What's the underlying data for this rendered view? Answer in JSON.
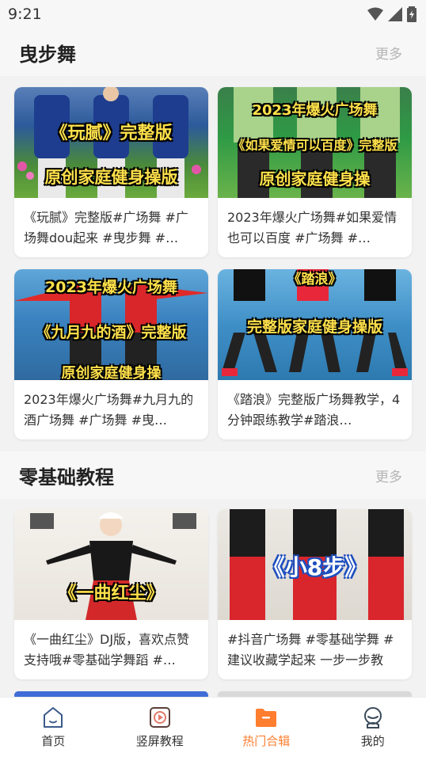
{
  "status_bar": {
    "time": "9:21"
  },
  "sections": [
    {
      "title": "曳步舞",
      "more_label": "更多",
      "cards": [
        {
          "thumb_lines": [
            "《玩腻》完整版",
            "原创家庭健身操版"
          ],
          "description": "《玩腻》完整版#广场舞 #广场舞dou起来 #曳步舞 #…"
        },
        {
          "thumb_lines": [
            "2023年爆火广场舞",
            "《如果爱情可以百度》完整版",
            "原创家庭健身操"
          ],
          "description": "2023年爆火广场舞#如果爱情也可以百度 #广场舞 #…"
        },
        {
          "thumb_lines": [
            "2023年爆火广场舞",
            "《九月九的酒》完整版",
            "原创家庭健身操"
          ],
          "description": "2023年爆火广场舞#九月九的酒广场舞 #广场舞 #曳…"
        },
        {
          "thumb_lines": [
            "《踏浪》",
            "完整版家庭健身操版"
          ],
          "description": "《踏浪》完整版广场舞教学，4分钟跟练教学#踏浪…"
        }
      ]
    },
    {
      "title": "零基础教程",
      "more_label": "更多",
      "cards": [
        {
          "thumb_lines": [
            "《一曲红尘》"
          ],
          "description": "《一曲红尘》DJ版，喜欢点赞支持哦#零基础学舞蹈 #…"
        },
        {
          "thumb_lines": [
            "《小8步》"
          ],
          "description": "#抖音广场舞 #零基础学舞 #建议收藏学起来 一步一步教"
        }
      ]
    }
  ],
  "bottom_nav": [
    {
      "label": "首页",
      "icon": "home-icon",
      "active": false
    },
    {
      "label": "竖屏教程",
      "icon": "play-icon",
      "active": false
    },
    {
      "label": "热门合辑",
      "icon": "folder-icon",
      "active": true
    },
    {
      "label": "我的",
      "icon": "profile-icon",
      "active": false
    }
  ],
  "colors": {
    "accent": "#ff7d2e",
    "thumb_text": "#ffe14a"
  }
}
